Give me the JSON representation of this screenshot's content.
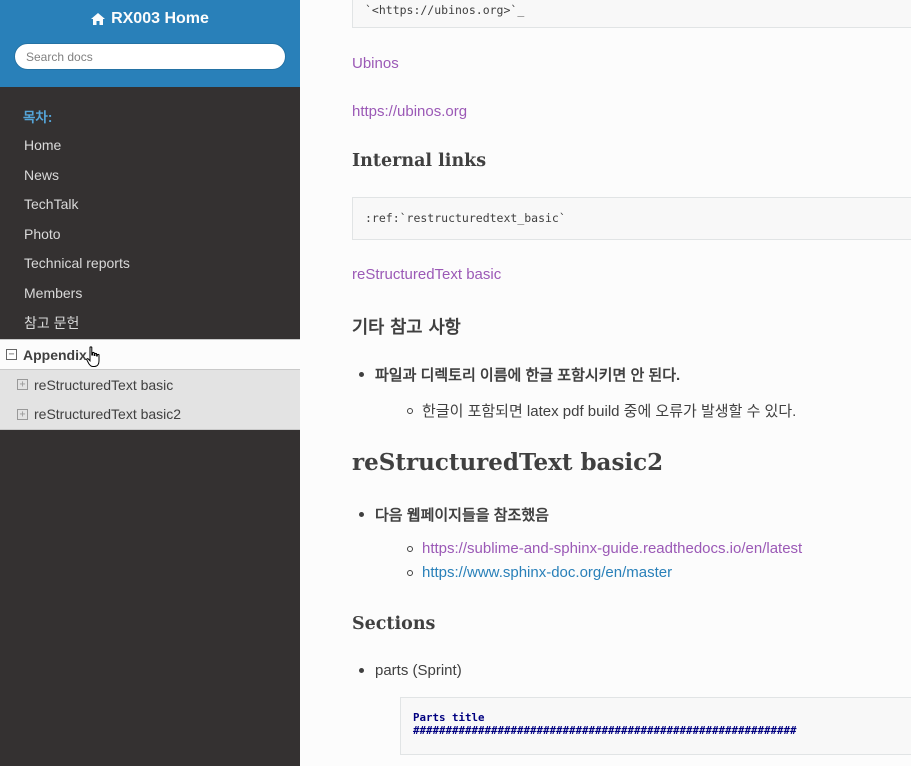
{
  "sidebar": {
    "home_label": "RX003 Home",
    "search_placeholder": "Search docs",
    "caption": "목차:",
    "items": [
      {
        "label": "Home"
      },
      {
        "label": "News"
      },
      {
        "label": "TechTalk"
      },
      {
        "label": "Photo"
      },
      {
        "label": "Technical reports"
      },
      {
        "label": "Members"
      },
      {
        "label": "참고 문헌"
      }
    ],
    "current": {
      "label": "Appendix",
      "toggle": "−"
    },
    "sub_items": [
      {
        "label": "reStructuredText basic",
        "toggle": "+"
      },
      {
        "label": "reStructuredText basic2",
        "toggle": "+"
      }
    ]
  },
  "content": {
    "code_top": "`<https://ubinos.org>`_",
    "link_ubinos": "Ubinos",
    "link_ubinos_url": "https://ubinos.org",
    "h_internal": "Internal links",
    "code_ref": ":ref:`restructuredtext_basic`",
    "link_rst_basic": "reStructuredText basic",
    "h_etc": "기타 참고 사항",
    "bullet_korean": "파일과 디렉토리 이름에 한글 포함시키면 안 된다.",
    "sub_bullet_korean": "한글이 포함되면 latex pdf build 중에 오류가 발생할 수 있다.",
    "h_basic2": "reStructuredText basic2",
    "bullet_ref": "다음 웹페이지들을 참조했음",
    "ref_links": [
      "https://sublime-and-sphinx-guide.readthedocs.io/en/latest",
      "https://www.sphinx-doc.org/en/master"
    ],
    "h_sections": "Sections",
    "bullet_parts": "parts (Sprint)",
    "code_parts_line1": "Parts title",
    "code_parts_line2": "###########################################################"
  },
  "colors": {
    "sidebar_bg": "#343131",
    "sidebar_top": "#2980b9",
    "link_visited": "#9b59b6",
    "link": "#2980b9"
  }
}
